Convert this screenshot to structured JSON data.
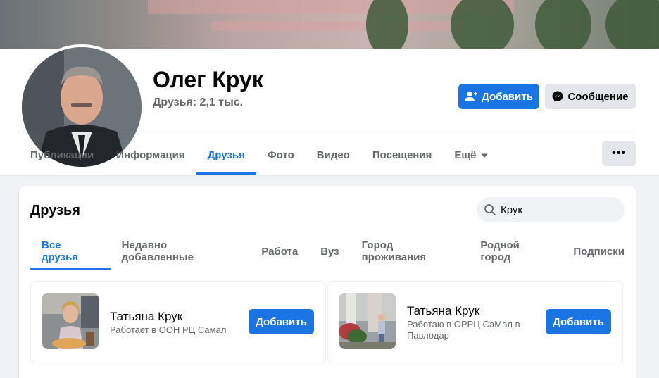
{
  "profile": {
    "name": "Олег Крук",
    "friends_count": "Друзья: 2,1 тыс.",
    "add_button": "Добавить",
    "message_button": "Сообщение",
    "more_button": "•••"
  },
  "nav": {
    "tabs": [
      {
        "label": "Публикации",
        "active": false
      },
      {
        "label": "Информация",
        "active": false
      },
      {
        "label": "Друзья",
        "active": true
      },
      {
        "label": "Фото",
        "active": false
      },
      {
        "label": "Видео",
        "active": false
      },
      {
        "label": "Посещения",
        "active": false
      },
      {
        "label": "Ещё",
        "active": false
      }
    ]
  },
  "friends_section": {
    "title": "Друзья",
    "search_value": "Крук",
    "subtabs": [
      {
        "label": "Все друзья",
        "active": true
      },
      {
        "label": "Недавно добавленные",
        "active": false
      },
      {
        "label": "Работа",
        "active": false
      },
      {
        "label": "Вуз",
        "active": false
      },
      {
        "label": "Город проживания",
        "active": false
      },
      {
        "label": "Родной город",
        "active": false
      },
      {
        "label": "Подписки",
        "active": false
      }
    ],
    "friends": [
      {
        "name": "Татьяна Крук",
        "work": "Работает в ООН РЦ Самал",
        "button": "Добавить"
      },
      {
        "name": "Татьяна Крук",
        "work": "Работаю в ОРРЦ СаМал в Павлодар",
        "button": "Добавить"
      }
    ]
  },
  "colors": {
    "accent": "#1b74e4",
    "secondary_button": "#e4e6eb",
    "muted_text": "#65676b"
  }
}
